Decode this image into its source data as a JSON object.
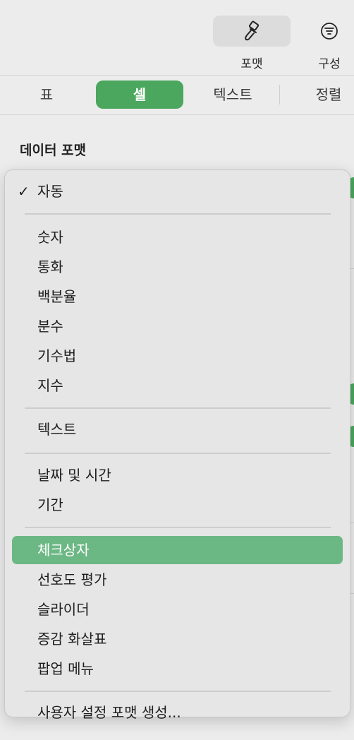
{
  "toolbar": {
    "format_label": "포맷",
    "arrange_label": "구성"
  },
  "tabs": {
    "table": "표",
    "cell": "셀",
    "text": "텍스트",
    "sort": "정렬"
  },
  "section": {
    "data_format_title": "데이터 포맷"
  },
  "menu": {
    "checkmark": "✓",
    "items": [
      "자동",
      "숫자",
      "통화",
      "백분율",
      "분수",
      "기수법",
      "지수",
      "텍스트",
      "날짜 및 시간",
      "기간",
      "체크상자",
      "선호도 평가",
      "슬라이더",
      "증감 화살표",
      "팝업 메뉴",
      "사용자 설정 포맷 생성..."
    ],
    "checked_item": "자동",
    "highlighted_item": "체크상자"
  },
  "colors": {
    "accent": "#4aa75d",
    "highlight": "#6cb884"
  }
}
